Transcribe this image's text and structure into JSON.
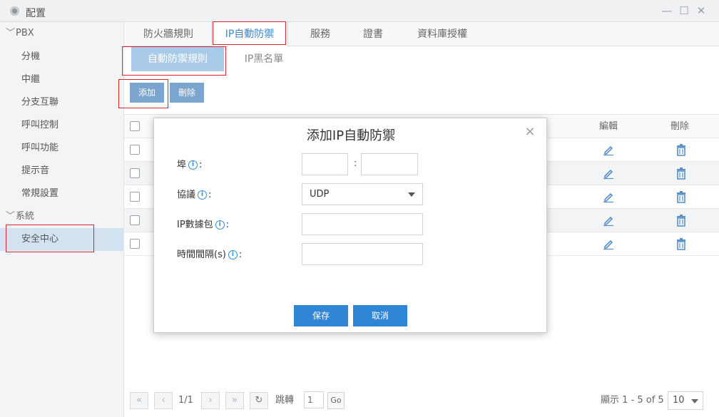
{
  "window": {
    "title": "配置",
    "minimize": "—",
    "maximize": "☐",
    "close": "✕"
  },
  "sidebar": {
    "groups": [
      {
        "label": "PBX",
        "items": [
          "分機",
          "中繼",
          "分支互聯",
          "呼叫控制",
          "呼叫功能",
          "提示音",
          "常規設置"
        ]
      },
      {
        "label": "系統",
        "items": [
          "安全中心"
        ]
      }
    ],
    "active_item": "安全中心"
  },
  "tabs": [
    {
      "label": "防火牆規則",
      "active": false
    },
    {
      "label": "IP自動防禦",
      "active": true
    },
    {
      "label": "服務",
      "active": false
    },
    {
      "label": "證書",
      "active": false
    },
    {
      "label": "資料庫授權",
      "active": false
    }
  ],
  "subtabs": [
    {
      "label": "自動防禦規則",
      "active": true
    },
    {
      "label": "IP黑名單",
      "active": false
    }
  ],
  "toolbar": {
    "add_label": "添加",
    "delete_label": "刪除"
  },
  "table": {
    "columns": {
      "edit": "編輯",
      "delete": "刪除"
    },
    "row_count": 5
  },
  "pagination": {
    "first": "«",
    "prev": "‹",
    "page": "1/1",
    "next": "›",
    "last": "»",
    "refresh": "↻",
    "jump_label": "跳轉",
    "jump_value": "1",
    "go_label": "Go",
    "display_text": "顯示 1 - 5 of 5",
    "page_size": "10"
  },
  "dialog": {
    "title": "添加IP自動防禦",
    "close": "×",
    "fields": {
      "port_label": "埠",
      "port_separator": ":",
      "protocol_label": "協議",
      "protocol_value": "UDP",
      "packets_label": "IP數據包",
      "interval_label": "時間間隔(s)"
    },
    "info_glyph": "i",
    "save_label": "保存",
    "cancel_label": "取消"
  },
  "colors": {
    "accent": "#2f86d6",
    "active_tab_text": "#3a87cc",
    "highlight": "#d6262c",
    "sidebar_active": "#d2e2f1"
  }
}
